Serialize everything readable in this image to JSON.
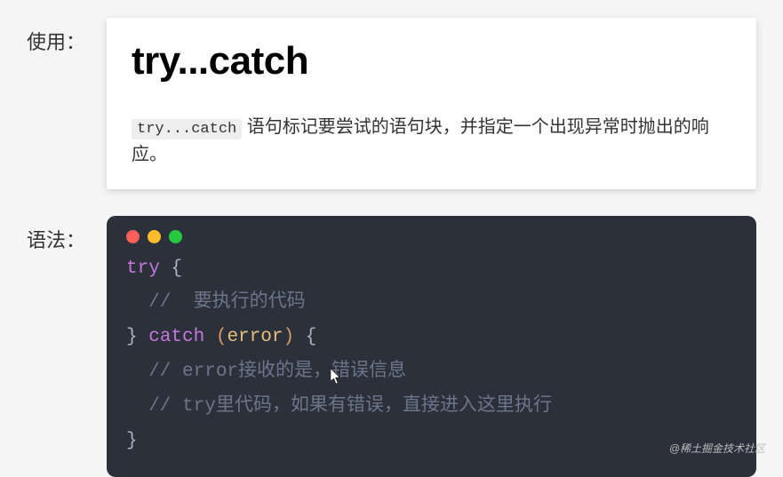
{
  "usage": {
    "label": "使用：",
    "title": "try...catch",
    "inline_code": "try...catch",
    "description_rest": " 语句标记要尝试的语句块，并指定一个出现异常时抛出的响应。"
  },
  "syntax": {
    "label": "语法：",
    "code": {
      "line1_kw": "try",
      "line1_brace": " {",
      "line2_comment": "  //  要执行的代码",
      "line3_close": "} ",
      "line3_catch": "catch",
      "line3_open_paren": " (",
      "line3_param": "error",
      "line3_close_paren": ")",
      "line3_brace": " {",
      "line4_comment": "  // error接收的是，错误信息",
      "line5_comment": "  // try里代码，如果有错误，直接进入这里执行",
      "line6_close": "}"
    }
  },
  "watermark": "@稀土掘金技术社区"
}
